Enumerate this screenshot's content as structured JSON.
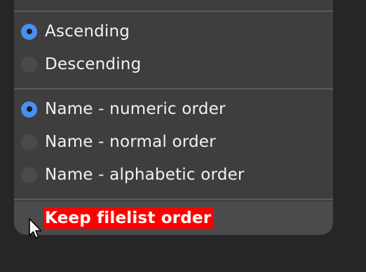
{
  "sort_menu": {
    "direction": [
      {
        "label": "Ascending",
        "selected": true
      },
      {
        "label": "Descending",
        "selected": false
      }
    ],
    "sort_by": [
      {
        "label": "Name - numeric order",
        "selected": true
      },
      {
        "label": "Name - normal order",
        "selected": false
      },
      {
        "label": "Name - alphabetic order",
        "selected": false
      }
    ],
    "keep_order": {
      "label": "Keep filelist order",
      "selected": false,
      "highlighted": true
    }
  },
  "colors": {
    "accent": "#4a8ff0",
    "highlight": "#ff0000",
    "menu_bg": "#3e3e3e"
  },
  "icons": {
    "cursor": "mouse-pointer-icon"
  }
}
